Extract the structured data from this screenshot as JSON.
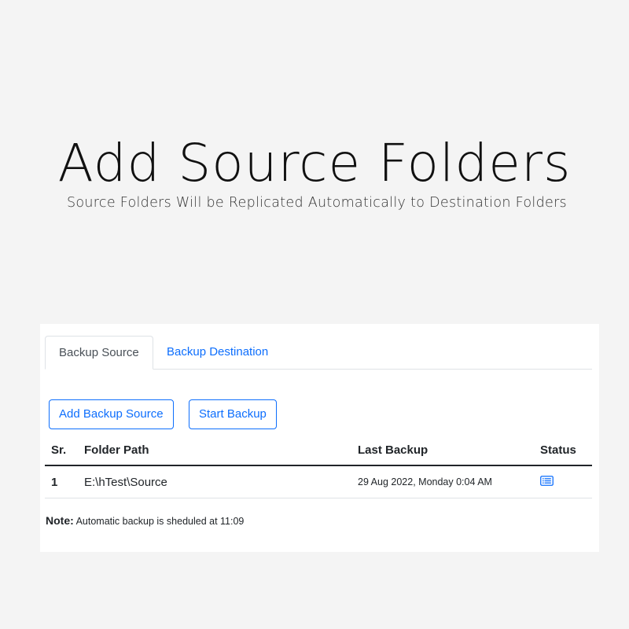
{
  "hero": {
    "title": "Add Source Folders",
    "subtitle": "Source Folders Will be Replicated Automatically to Destination Folders"
  },
  "tabs": [
    {
      "label": "Backup Source",
      "active": true
    },
    {
      "label": "Backup Destination",
      "active": false
    }
  ],
  "toolbar": {
    "add_label": "Add Backup Source",
    "start_label": "Start Backup"
  },
  "table": {
    "headers": {
      "sr": "Sr.",
      "path": "Folder Path",
      "last": "Last Backup",
      "status": "Status"
    },
    "rows": [
      {
        "sr": "1",
        "path": "E:\\hTest\\Source",
        "last": "29 Aug 2022, Monday 0:04 AM",
        "status_icon": "list-details-icon"
      }
    ]
  },
  "note": {
    "label": "Note:",
    "text": "Automatic backup is sheduled at 11:09"
  },
  "colors": {
    "accent": "#0d6efd",
    "background": "#f4f4f4",
    "panel": "#ffffff"
  }
}
